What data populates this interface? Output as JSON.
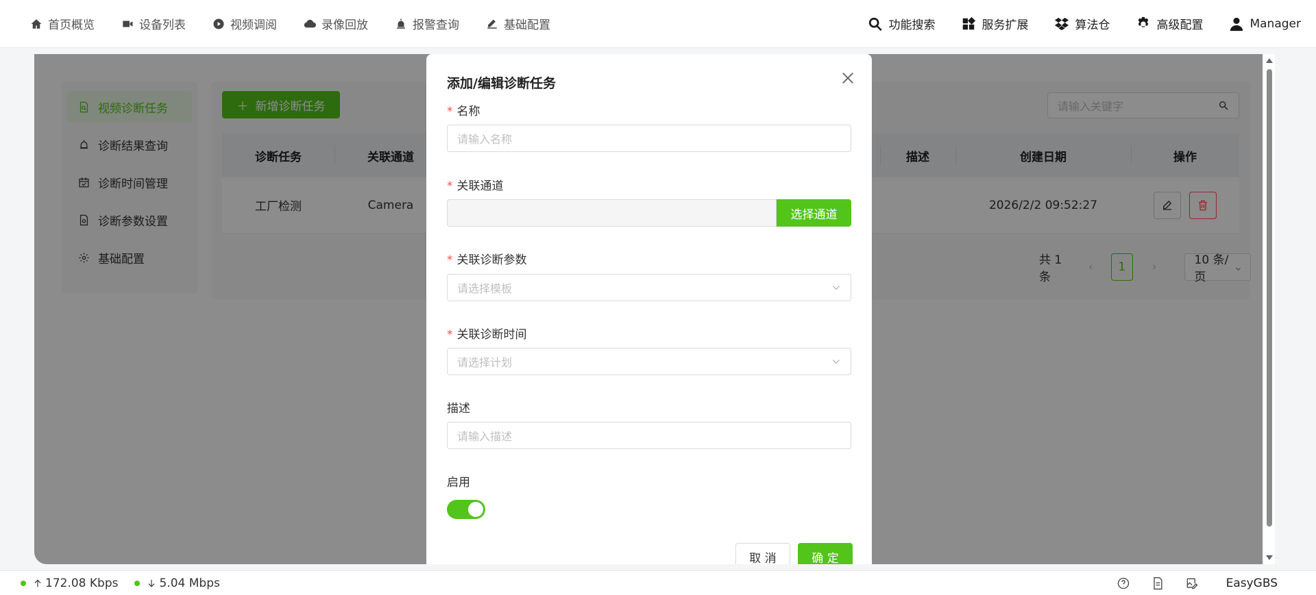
{
  "nav": {
    "left": [
      {
        "label": "首页概览",
        "icon": "home-icon"
      },
      {
        "label": "设备列表",
        "icon": "camera-icon"
      },
      {
        "label": "视频调阅",
        "icon": "play-icon"
      },
      {
        "label": "录像回放",
        "icon": "cloud-icon"
      },
      {
        "label": "报警查询",
        "icon": "alarm-icon"
      },
      {
        "label": "基础配置",
        "icon": "edit-icon"
      }
    ],
    "right": [
      {
        "label": "功能搜索",
        "icon": "search-icon"
      },
      {
        "label": "服务扩展",
        "icon": "grid-icon"
      },
      {
        "label": "算法仓",
        "icon": "dropbox-icon"
      },
      {
        "label": "高级配置",
        "icon": "gear-icon"
      },
      {
        "label": "Manager",
        "icon": "user-icon"
      }
    ]
  },
  "sidebar": {
    "items": [
      {
        "label": "视频诊断任务",
        "active": true
      },
      {
        "label": "诊断结果查询",
        "active": false
      },
      {
        "label": "诊断时间管理",
        "active": false
      },
      {
        "label": "诊断参数设置",
        "active": false
      },
      {
        "label": "基础配置",
        "active": false
      }
    ]
  },
  "toolbar": {
    "add_label": "新增诊断任务",
    "search_placeholder": "请输入关键字"
  },
  "table": {
    "columns": [
      "诊断任务",
      "关联通道",
      "描述",
      "创建日期",
      "操作"
    ],
    "rows": [
      {
        "task": "工厂检测",
        "channel": "Camera",
        "desc": "",
        "created": "2026/2/2 09:52:27"
      }
    ]
  },
  "pagination": {
    "total": "共 1 条",
    "current": "1",
    "page_size": "10 条/页"
  },
  "modal": {
    "title": "添加/编辑诊断任务",
    "name_label": "名称",
    "name_placeholder": "请输入名称",
    "channel_label": "关联通道",
    "channel_btn": "选择通道",
    "param_label": "关联诊断参数",
    "param_placeholder": "请选择模板",
    "time_label": "关联诊断时间",
    "time_placeholder": "请选择计划",
    "desc_label": "描述",
    "desc_placeholder": "请输入描述",
    "enable_label": "启用",
    "enabled": true,
    "cancel": "取 消",
    "ok": "确 定"
  },
  "status": {
    "upload": "172.08 Kbps",
    "download": "5.04 Mbps",
    "brand": "EasyGBS"
  },
  "colors": {
    "accent": "#52c41a",
    "danger": "#ff4d4f"
  }
}
